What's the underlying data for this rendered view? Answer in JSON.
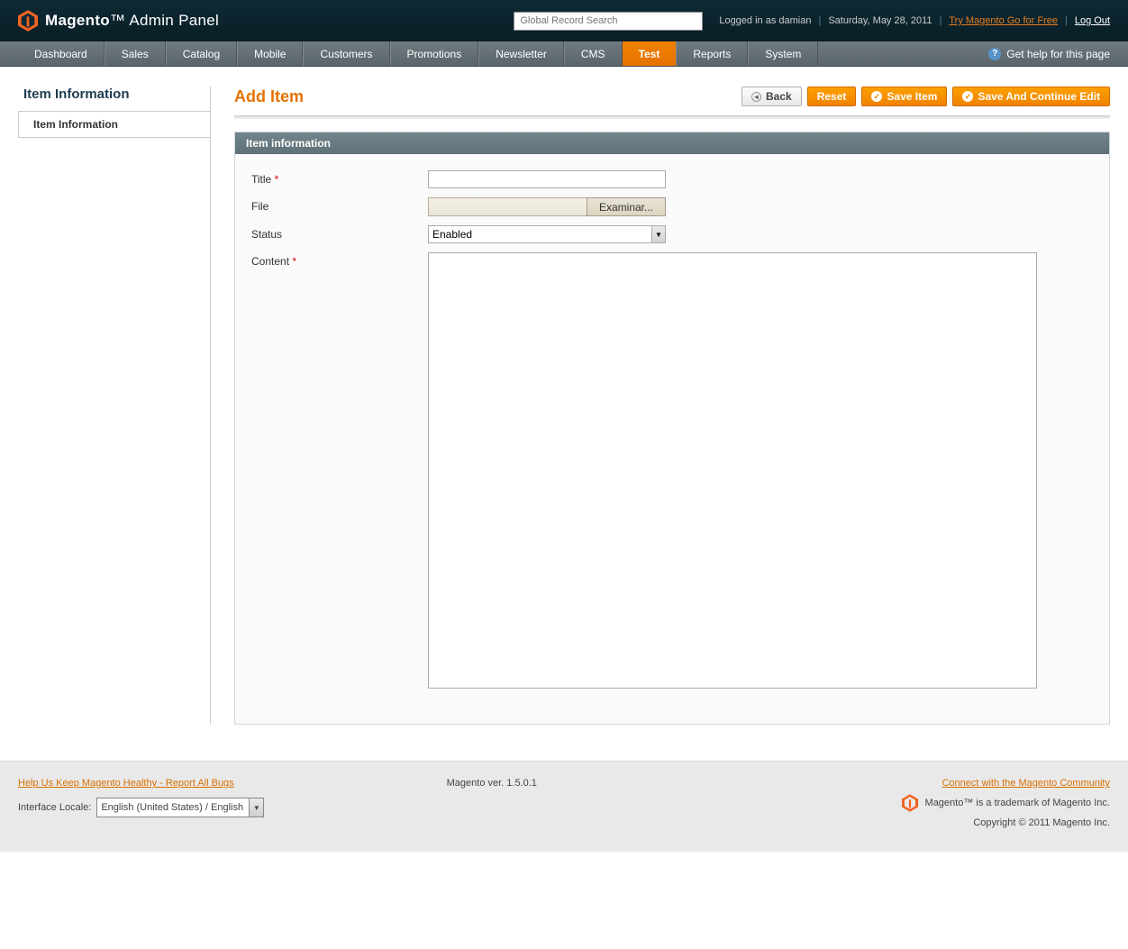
{
  "header": {
    "brand_main": "Magento",
    "brand_sub": "Admin Panel",
    "search_placeholder": "Global Record Search",
    "logged_in_text": "Logged in as damian",
    "date_text": "Saturday, May 28, 2011",
    "try_link": "Try Magento Go for Free",
    "logout_link": "Log Out"
  },
  "nav": {
    "items": [
      "Dashboard",
      "Sales",
      "Catalog",
      "Mobile",
      "Customers",
      "Promotions",
      "Newsletter",
      "CMS",
      "Test",
      "Reports",
      "System"
    ],
    "active_index": 8,
    "help_text": "Get help for this page"
  },
  "sidebar": {
    "title": "Item Information",
    "tab_label": "Item Information"
  },
  "page": {
    "title": "Add Item",
    "buttons": {
      "back": "Back",
      "reset": "Reset",
      "save": "Save Item",
      "save_continue": "Save And Continue Edit"
    }
  },
  "panel": {
    "heading": "Item information",
    "fields": {
      "title_label": "Title",
      "title_value": "",
      "file_label": "File",
      "file_button": "Examinar...",
      "status_label": "Status",
      "status_value": "Enabled",
      "content_label": "Content",
      "content_value": ""
    }
  },
  "footer": {
    "bugs_link": "Help Us Keep Magento Healthy - Report All Bugs",
    "locale_label": "Interface Locale:",
    "locale_value": "English (United States) / English",
    "version": "Magento ver. 1.5.0.1",
    "community_link": "Connect with the Magento Community",
    "trademark": "Magento™ is a trademark of Magento Inc.",
    "copyright": "Copyright © 2011 Magento Inc."
  }
}
